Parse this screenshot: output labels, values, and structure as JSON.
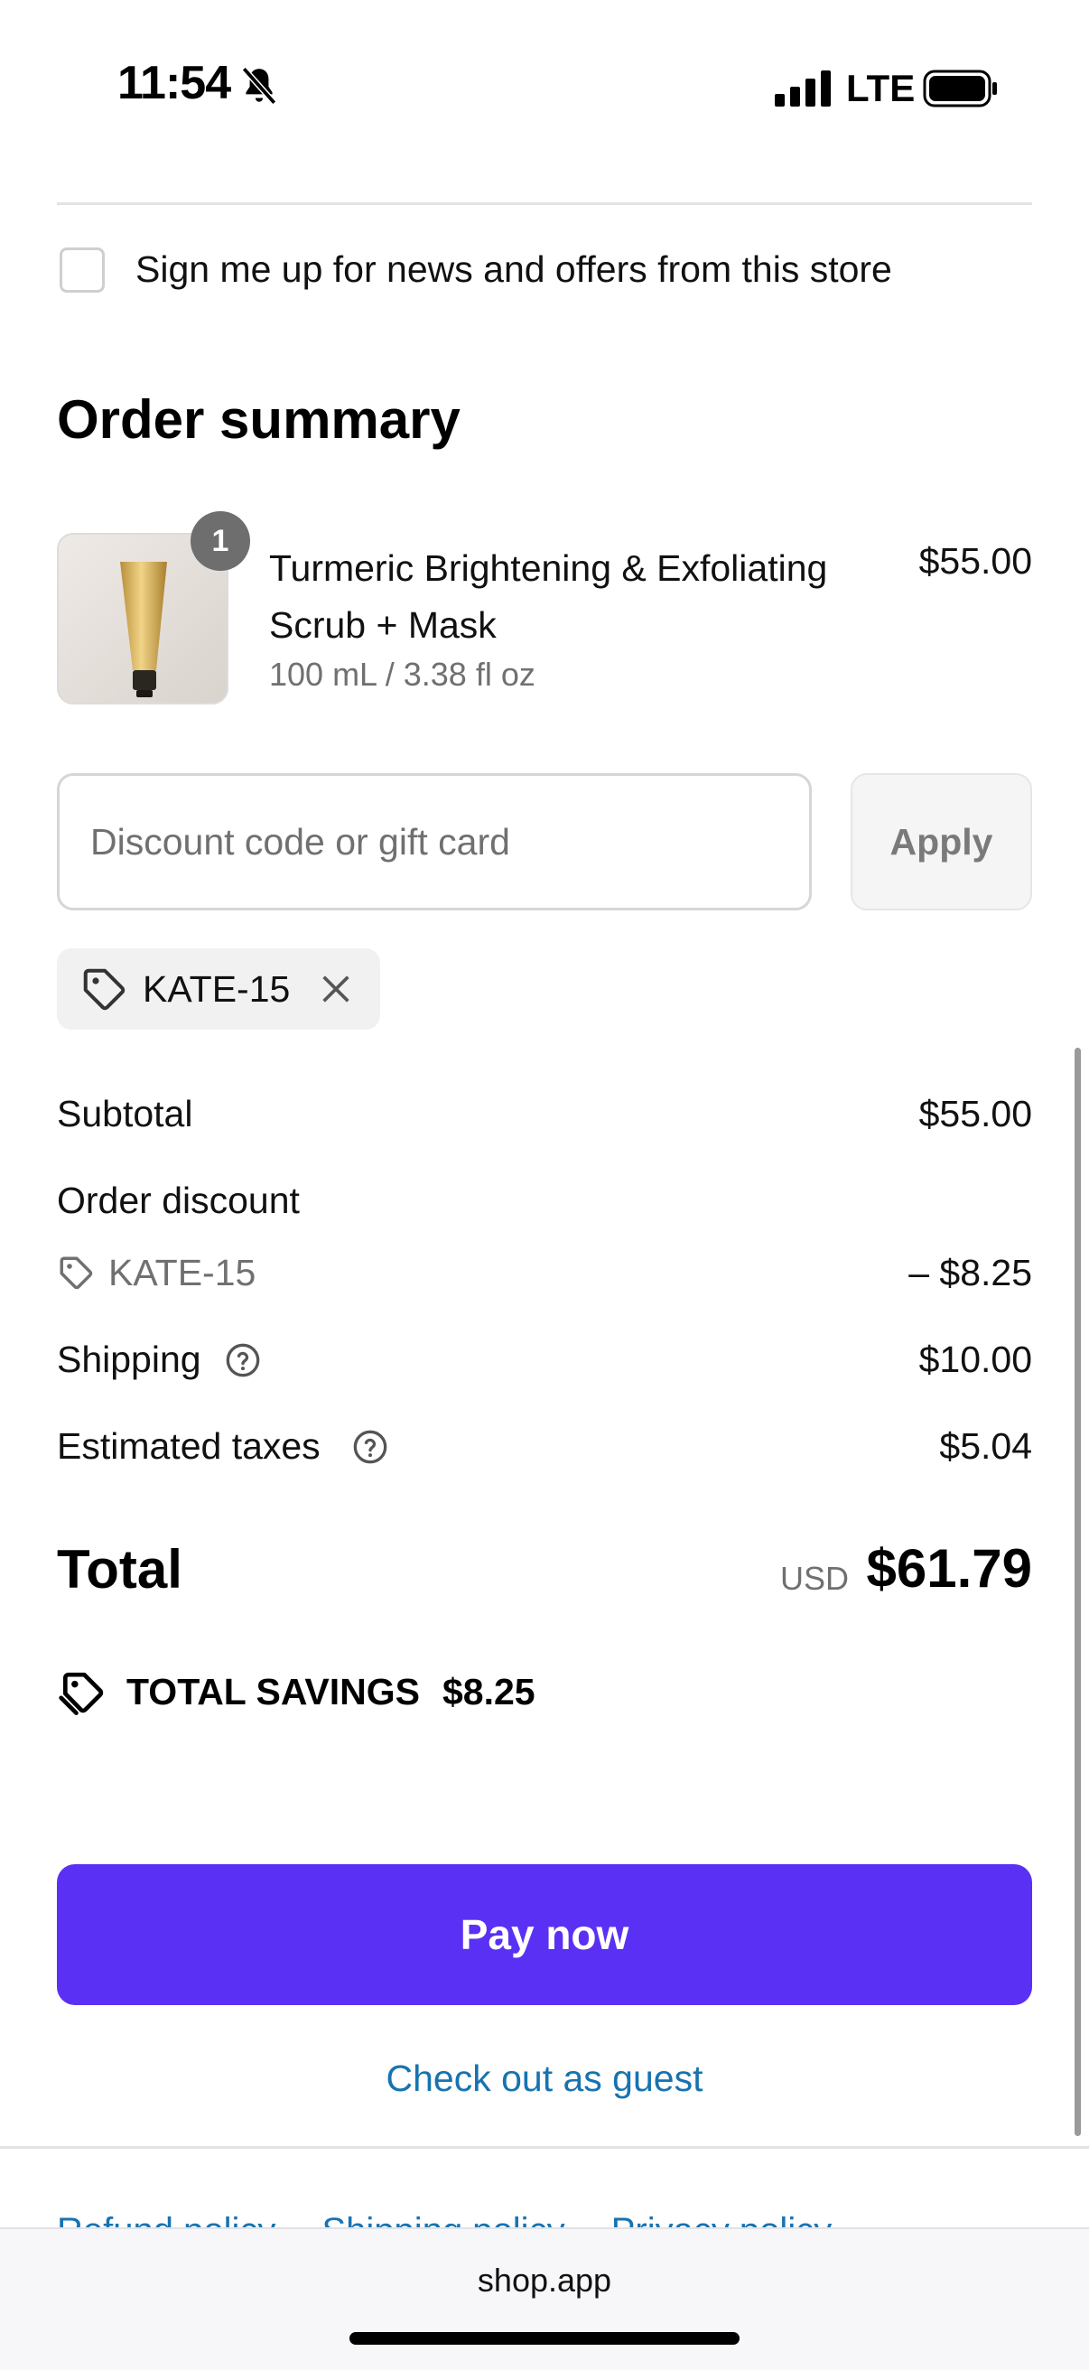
{
  "status_bar": {
    "time": "11:54",
    "network": "LTE"
  },
  "newsletter": {
    "label": "Sign me up for news and offers from this store",
    "checked": false
  },
  "order_summary": {
    "title": "Order summary",
    "item": {
      "quantity": "1",
      "name": "Turmeric Brightening & Exfoliating Scrub + Mask",
      "variant": "100 mL / 3.38 fl oz",
      "price": "$55.00"
    }
  },
  "discount": {
    "placeholder": "Discount code or gift card",
    "apply_label": "Apply",
    "applied_code": "KATE-15"
  },
  "totals": {
    "subtotal_label": "Subtotal",
    "subtotal_value": "$55.00",
    "order_discount_label": "Order discount",
    "discount_code": "KATE-15",
    "discount_value": "– $8.25",
    "shipping_label": "Shipping",
    "shipping_value": "$10.00",
    "taxes_label": "Estimated taxes",
    "taxes_value": "$5.04",
    "total_label": "Total",
    "currency": "USD",
    "total_value": "$61.79",
    "savings_label": "TOTAL SAVINGS",
    "savings_value": "$8.25"
  },
  "actions": {
    "pay_label": "Pay now",
    "guest_label": "Check out as guest"
  },
  "footer": {
    "policies": [
      "Refund policy",
      "Shipping policy",
      "Privacy policy"
    ]
  },
  "browser": {
    "url": "shop.app"
  },
  "colors": {
    "primary": "#5a31f4",
    "link": "#1773b0",
    "muted": "#707070"
  },
  "icons": [
    "bell-slash-icon",
    "signal-icon",
    "battery-icon",
    "tag-icon",
    "close-icon",
    "help-icon",
    "savings-tag-icon"
  ]
}
